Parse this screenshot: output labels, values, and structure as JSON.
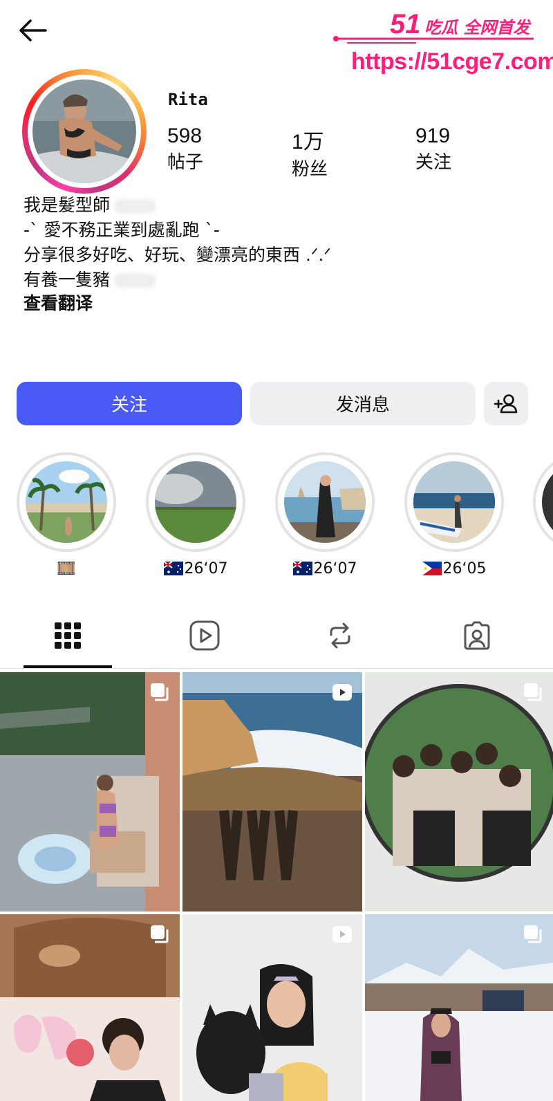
{
  "watermark": {
    "logo_number": "51",
    "logo_text": "吃瓜 全网首发",
    "url": "https://51cge7.com"
  },
  "header": {
    "back_icon": "arrow-left-icon"
  },
  "profile": {
    "username": "Rita",
    "stats": [
      {
        "value": "598",
        "label": "帖子"
      },
      {
        "value": "1万",
        "label": "粉丝"
      },
      {
        "value": "919",
        "label": "关注"
      }
    ],
    "bio_lines": [
      "我是髮型師",
      "-` 愛不務正業到處亂跑 `-",
      "分享很多好吃、好玩、變漂亮的東西 .ᐟ.ᐟ",
      "有養一隻豬"
    ],
    "translate_link": "查看翻译"
  },
  "actions": {
    "follow_label": "关注",
    "message_label": "发消息",
    "add_user_icon": "add-user-icon",
    "follow_color": "#4a5af5"
  },
  "highlights": [
    {
      "label": "🎞️",
      "icon": "film-icon"
    },
    {
      "label": "26‘07",
      "flag": "australia-flag-icon"
    },
    {
      "label": "26‘07",
      "flag": "australia-flag-icon"
    },
    {
      "label": "26‘05",
      "flag": "philippines-flag-icon"
    }
  ],
  "tabs": [
    {
      "name": "grid",
      "icon": "grid-icon",
      "active": true
    },
    {
      "name": "reels",
      "icon": "reels-play-icon",
      "active": false
    },
    {
      "name": "reposts",
      "icon": "repost-icon",
      "active": false
    },
    {
      "name": "tagged",
      "icon": "tagged-person-icon",
      "active": false
    }
  ],
  "posts": [
    {
      "type": "carousel",
      "badge_icon": "carousel-icon"
    },
    {
      "type": "reel",
      "badge_icon": "reel-icon"
    },
    {
      "type": "carousel",
      "badge_icon": "carousel-icon"
    },
    {
      "type": "carousel",
      "badge_icon": "carousel-icon"
    },
    {
      "type": "reel",
      "badge_icon": "reel-icon"
    },
    {
      "type": "carousel",
      "badge_icon": "carousel-icon"
    }
  ]
}
